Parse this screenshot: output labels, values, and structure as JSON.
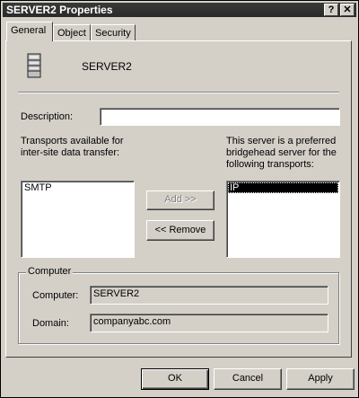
{
  "window": {
    "title": "SERVER2 Properties",
    "help_button": "?",
    "close_button": "✕"
  },
  "tabs": [
    {
      "label": "General",
      "active": true
    },
    {
      "label": "Object",
      "active": false
    },
    {
      "label": "Security",
      "active": false
    }
  ],
  "general": {
    "icon": "server-icon",
    "server_name": "SERVER2",
    "description_label": "Description:",
    "description_value": "",
    "transports_available_label_line1": "Transports available for",
    "transports_available_label_line2": "inter-site data transfer:",
    "transports_available": [
      "SMTP"
    ],
    "preferred_label_line1": "This server is a preferred",
    "preferred_label_line2": "bridgehead server for the",
    "preferred_label_line3": "following transports:",
    "preferred_transports": [
      "IP"
    ],
    "add_button": "Add >>",
    "remove_button": "<< Remove"
  },
  "computer_group": {
    "label": "Computer",
    "computer_label": "Computer:",
    "computer_value": "SERVER2",
    "domain_label": "Domain:",
    "domain_value": "companyabc.com"
  },
  "footer": {
    "ok": "OK",
    "cancel": "Cancel",
    "apply": "Apply"
  }
}
